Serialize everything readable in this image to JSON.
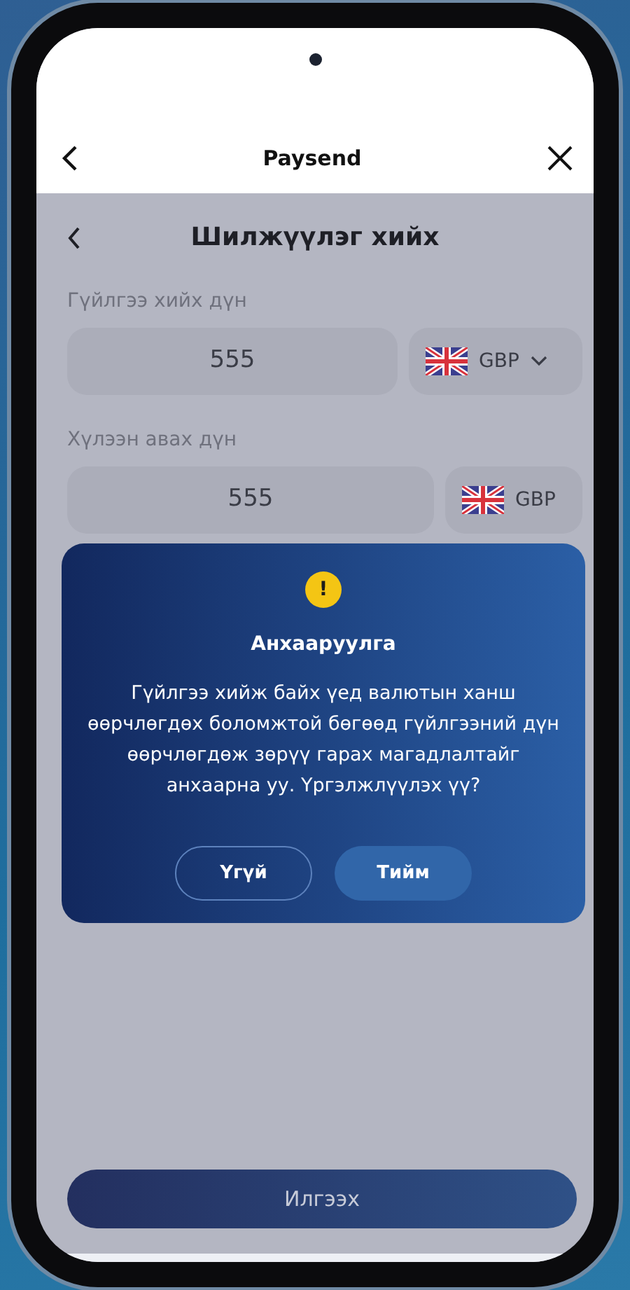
{
  "header": {
    "title": "Paysend"
  },
  "page": {
    "title": "Шилжүүлэг хийх"
  },
  "fields": [
    {
      "label": "Гүйлгээ хийх дүн",
      "value": "555",
      "currency": "GBP",
      "dropdown": true
    },
    {
      "label": "Хүлээн авах дүн",
      "value": "555",
      "currency": "GBP",
      "dropdown": false
    }
  ],
  "dialog": {
    "icon": "!",
    "title": "Анхааруулга",
    "message": "Гүйлгээ хийж байх үед валютын ханш өөрчлөгдөх боломжтой бөгөөд гүйлгээний дүн өөрчлөгдөж зөрүү гарах магадлалтайг анхаарна уу. Үргэлжлүүлэх үү?",
    "buttons": [
      {
        "label": "Үгүй",
        "kind": "outline"
      },
      {
        "label": "Тийм",
        "kind": "filled"
      }
    ]
  },
  "submit_button": "Илгээх"
}
